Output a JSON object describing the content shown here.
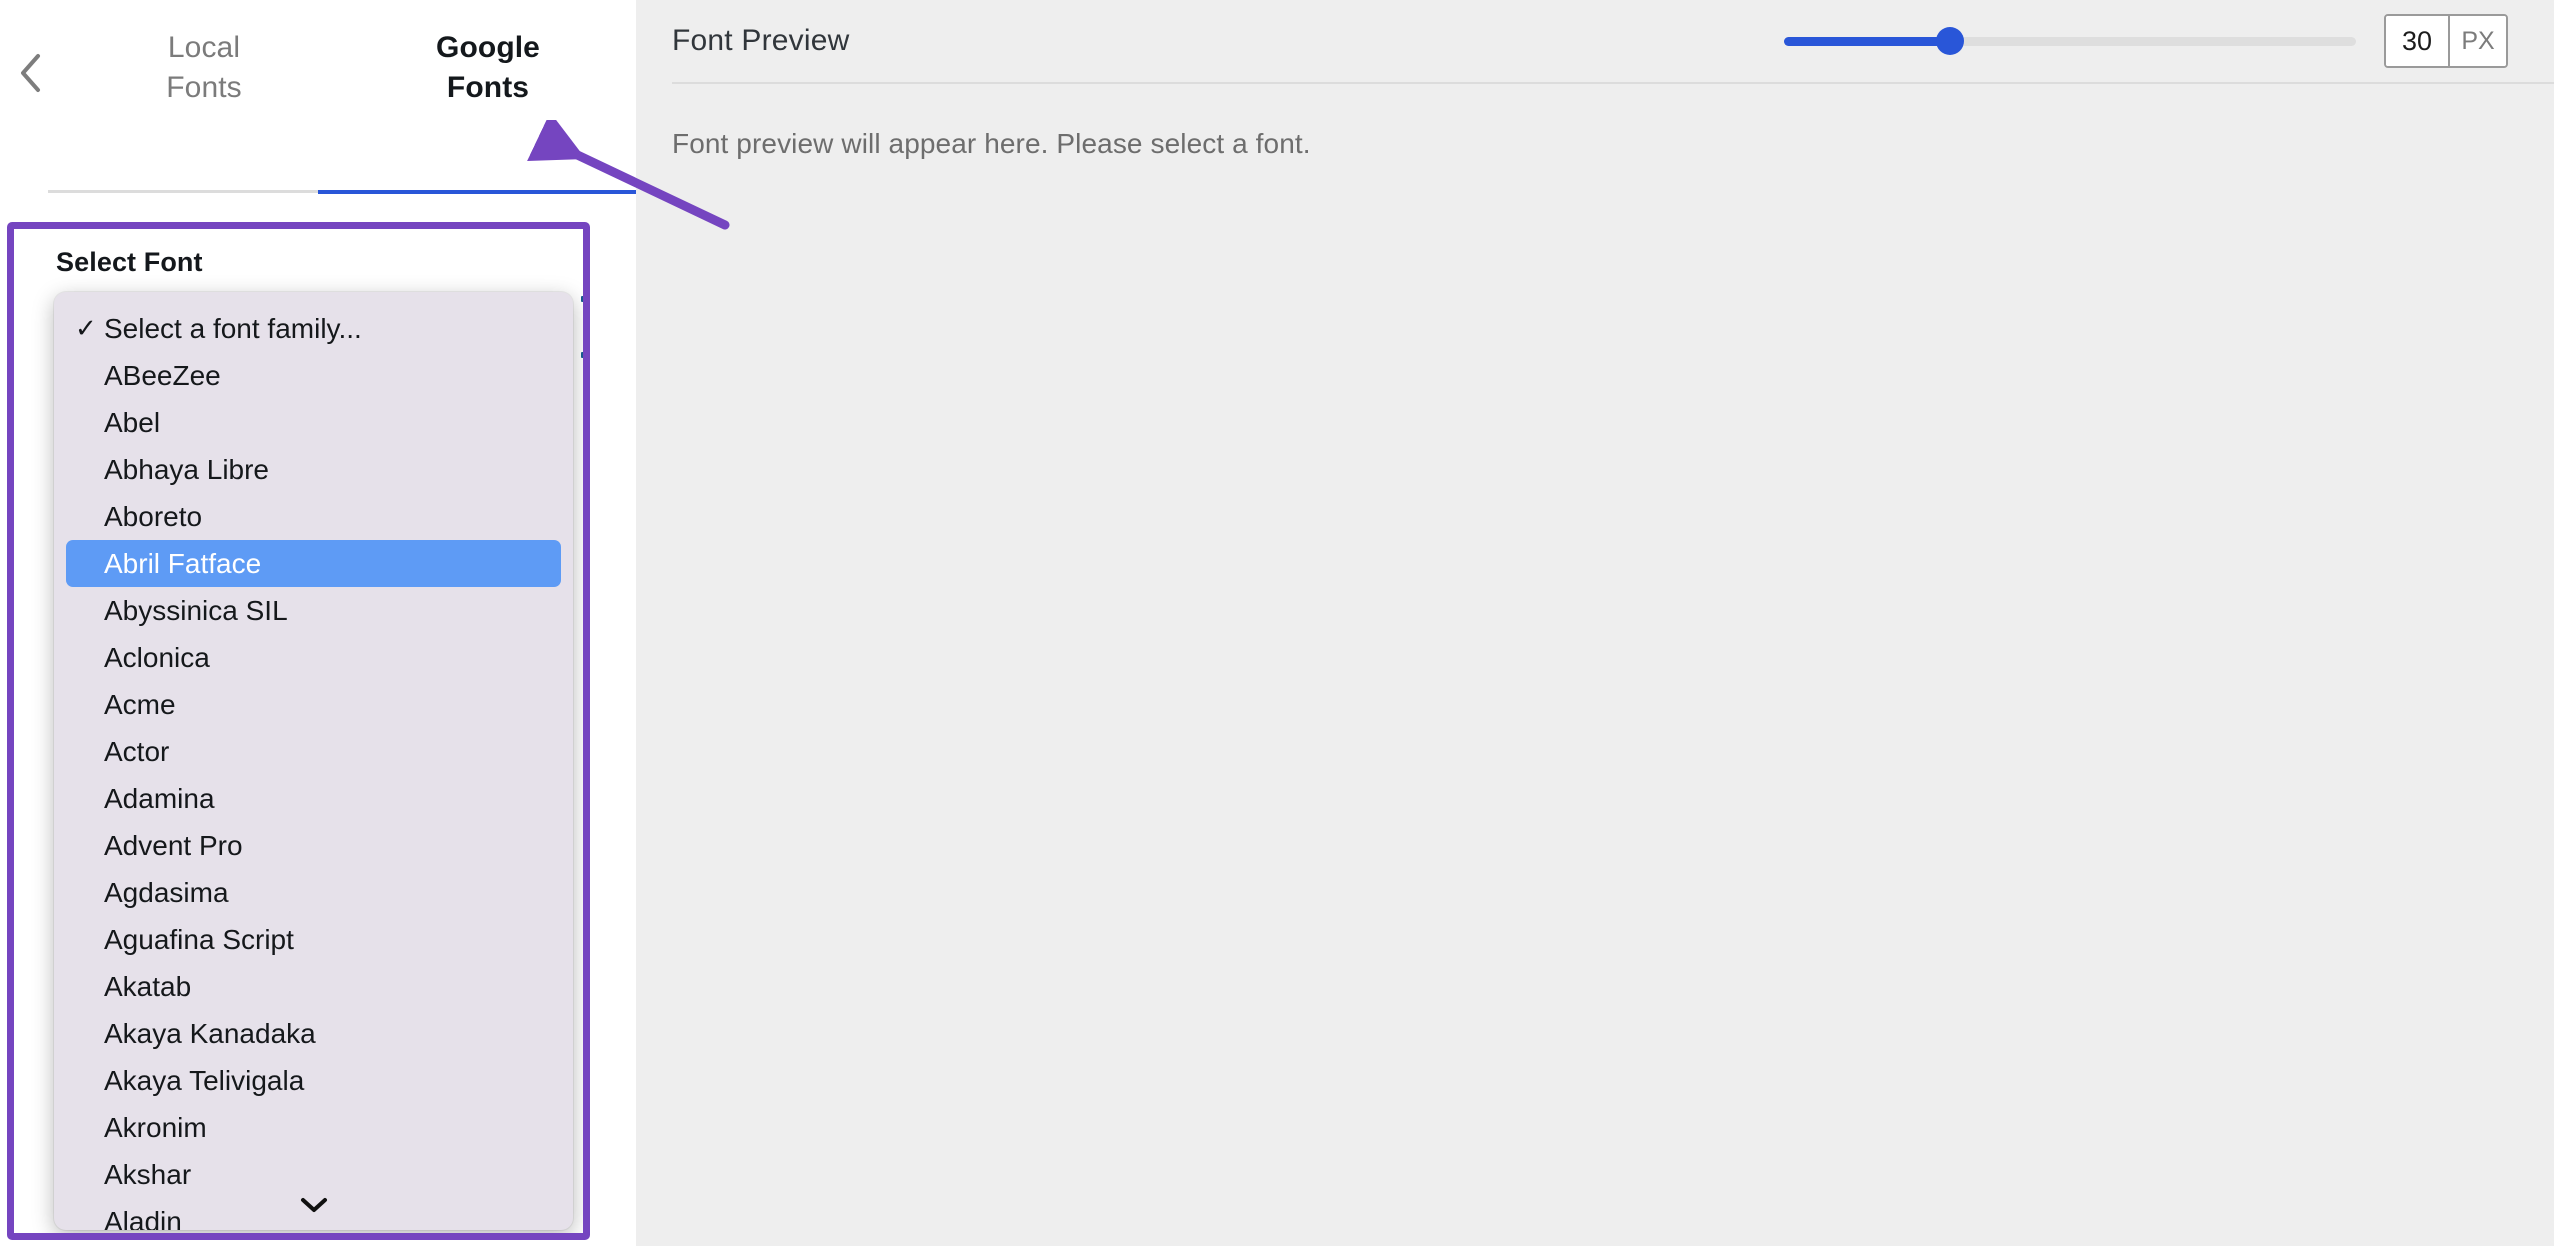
{
  "left_panel": {
    "back_button": {
      "icon": "chevron-left-icon"
    },
    "tabs": [
      {
        "label": "Local\nFonts",
        "line1": "Local",
        "line2": "Fonts",
        "active": false
      },
      {
        "label": "Google\nFonts",
        "line1": "Google",
        "line2": "Fonts",
        "active": true
      }
    ],
    "select_font": {
      "title": "Select Font",
      "selected_value": "Abril Fatface",
      "checked_value": "Select a font family...",
      "scroll_down_icon": "chevron-down-icon",
      "options": [
        "Select a font family...",
        "ABeeZee",
        "Abel",
        "Abhaya Libre",
        "Aboreto",
        "Abril Fatface",
        "Abyssinica SIL",
        "Aclonica",
        "Acme",
        "Actor",
        "Adamina",
        "Advent Pro",
        "Agdasima",
        "Aguafina Script",
        "Akatab",
        "Akaya Kanadaka",
        "Akaya Telivigala",
        "Akronim",
        "Akshar",
        "Aladin"
      ]
    }
  },
  "right_panel": {
    "title": "Font Preview",
    "preview_placeholder": "Font preview will appear here. Please select a font.",
    "font_size": {
      "value": "30",
      "unit": "PX",
      "slider_percent": 29,
      "min": 0,
      "max": 100
    }
  },
  "annotation": {
    "arrow_color": "#7545c0",
    "highlight_box_color": "#7545c0"
  },
  "colors": {
    "accent_blue": "#2956d8",
    "selection_blue": "#5e9bf5",
    "annotation_purple": "#7545c0",
    "panel_bg": "#eeeeee",
    "dropdown_bg": "#e6e1ea"
  }
}
